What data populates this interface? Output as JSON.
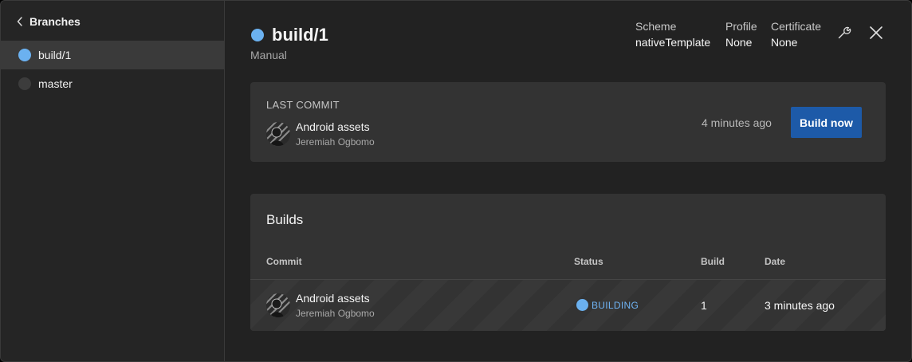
{
  "colors": {
    "building_blue": "#6bb1f0",
    "idle_dot": "#3c3c3c",
    "primary_button": "#1d5aa8",
    "status_text": "#6fb3f3"
  },
  "sidebar": {
    "back_label": "Branches",
    "items": [
      {
        "label": "build/1",
        "state": "building",
        "active": true
      },
      {
        "label": "master",
        "state": "idle",
        "active": false
      }
    ]
  },
  "header": {
    "branch": "build/1",
    "trigger": "Manual",
    "meta": [
      {
        "label": "Scheme",
        "value": "nativeTemplate"
      },
      {
        "label": "Profile",
        "value": "None"
      },
      {
        "label": "Certificate",
        "value": "None"
      }
    ],
    "icons": [
      "wrench-icon",
      "close-icon"
    ]
  },
  "last_commit": {
    "label": "LAST COMMIT",
    "message": "Android assets",
    "author": "Jeremiah Ogbomo",
    "time": "4 minutes ago",
    "build_button": "Build now"
  },
  "builds": {
    "title": "Builds",
    "columns": [
      "Commit",
      "Status",
      "Build",
      "Date"
    ],
    "rows": [
      {
        "message": "Android assets",
        "author": "Jeremiah Ogbomo",
        "status": "BUILDING",
        "build": "1",
        "date": "3 minutes ago"
      }
    ]
  }
}
